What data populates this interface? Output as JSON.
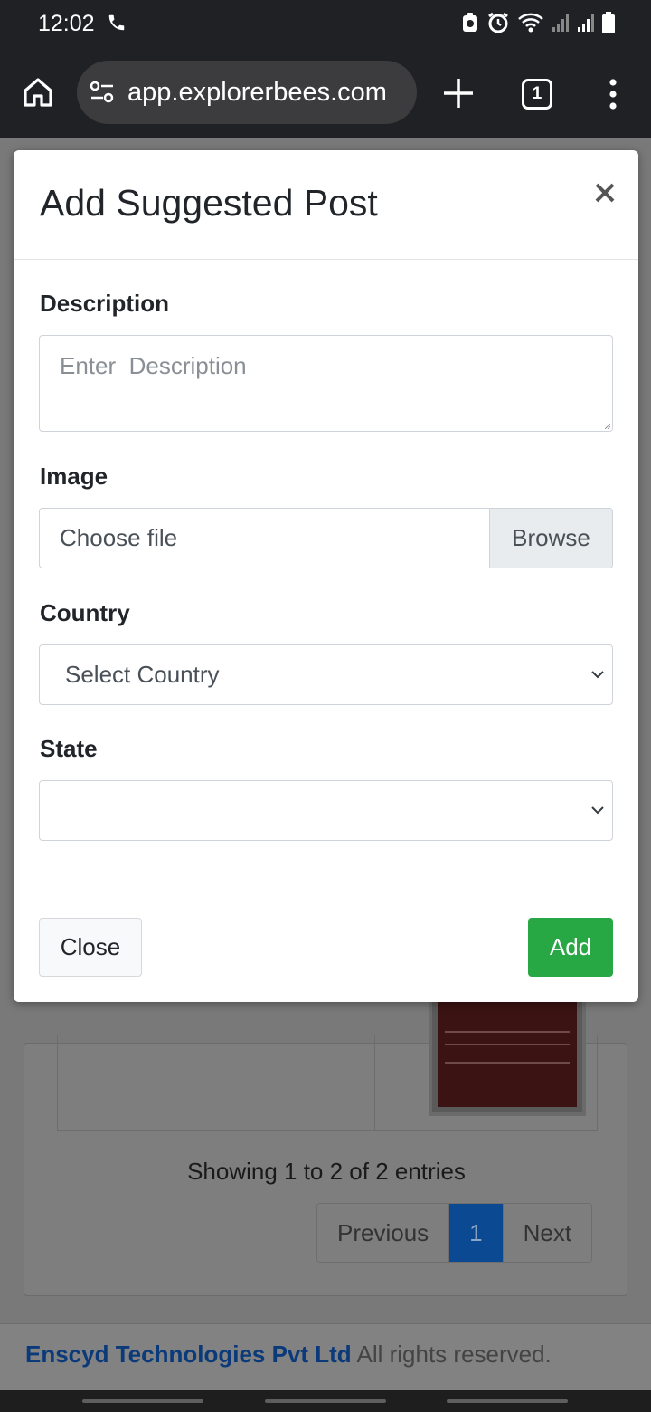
{
  "status_bar": {
    "time": "12:02"
  },
  "browser": {
    "url": "app.explorerbees.com",
    "tab_count": "1"
  },
  "modal": {
    "title": "Add Suggested Post",
    "close_symbol": "×",
    "description": {
      "label": "Description",
      "placeholder": "Enter  Description",
      "value": ""
    },
    "image": {
      "label": "Image",
      "file_text": "Choose file",
      "browse_label": "Browse"
    },
    "country": {
      "label": "Country",
      "selected": "Select Country"
    },
    "state": {
      "label": "State",
      "selected": ""
    },
    "footer": {
      "close_label": "Close",
      "add_label": "Add"
    }
  },
  "background_page": {
    "entries_text": "Showing 1 to 2 of 2 entries",
    "pagination": {
      "previous": "Previous",
      "current": "1",
      "next": "Next"
    },
    "footer": {
      "company": "Enscyd Technologies Pvt Ltd",
      "rights": "All rights reserved."
    }
  },
  "colors": {
    "accent_blue": "#0b4a93",
    "add_green": "#28a745",
    "chrome_dark": "#202124"
  }
}
